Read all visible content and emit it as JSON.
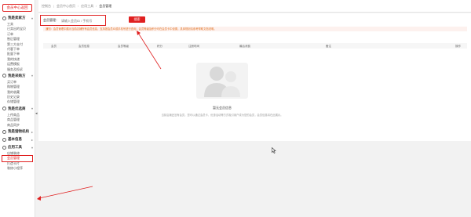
{
  "sidebar": {
    "logo_button": "会员中心返回",
    "groups": [
      {
        "label": "我是卖家方",
        "items": [
          "工卖",
          "已卖出的宝贝",
          "订单",
          "售后管理",
          "第三方支付",
          "代客下单",
          "批量下单",
          "我的快递",
          "运费模板",
          "服务及投诉"
        ]
      },
      {
        "label": "我是采购方",
        "items": [
          "买订单",
          "购物管理",
          "我的收藏",
          "历史记录",
          "存储管理"
        ]
      },
      {
        "label": "我是优选商",
        "items": [
          "上传商品",
          "商品管理",
          "商品同步"
        ]
      },
      {
        "label": "我是猎物机构",
        "items": []
      },
      {
        "label": "基本信息",
        "items": []
      },
      {
        "label": "应用工具",
        "items": [
          "店铺装修",
          "会员管理",
          "打造卡片",
          "装修小程序"
        ]
      }
    ],
    "highlighted_item": "会员管理"
  },
  "topbar": {
    "crumbs": [
      "控制台",
      "会员中心首页",
      "应用工具",
      "会员管理"
    ]
  },
  "search": {
    "label": "会员管理：",
    "placeholder": "请输入会员ID / 手机号",
    "button": "搜索"
  },
  "notice": "通知：会员管理中展示当前店铺所有会员信息，支持按会员ID或手机号进行查询，会员等级及积分可在会员卡中设置，具体规则请参考帮助文档说明。",
  "table": {
    "columns": [
      "会员",
      "会员信息",
      "会员等级",
      "积分",
      "注册时间",
      "最后消费",
      "备注",
      "操作"
    ]
  },
  "empty": {
    "title": "暂无会员信息",
    "description": "当前店铺还没有会员，您可以通过会员卡、优惠活动等方式吸引用户成为您的会员，会员信息将在此展示。"
  },
  "colors": {
    "accent": "#e02020",
    "notice_text": "#e0701f",
    "notice_bg": "#fdf1ee"
  }
}
